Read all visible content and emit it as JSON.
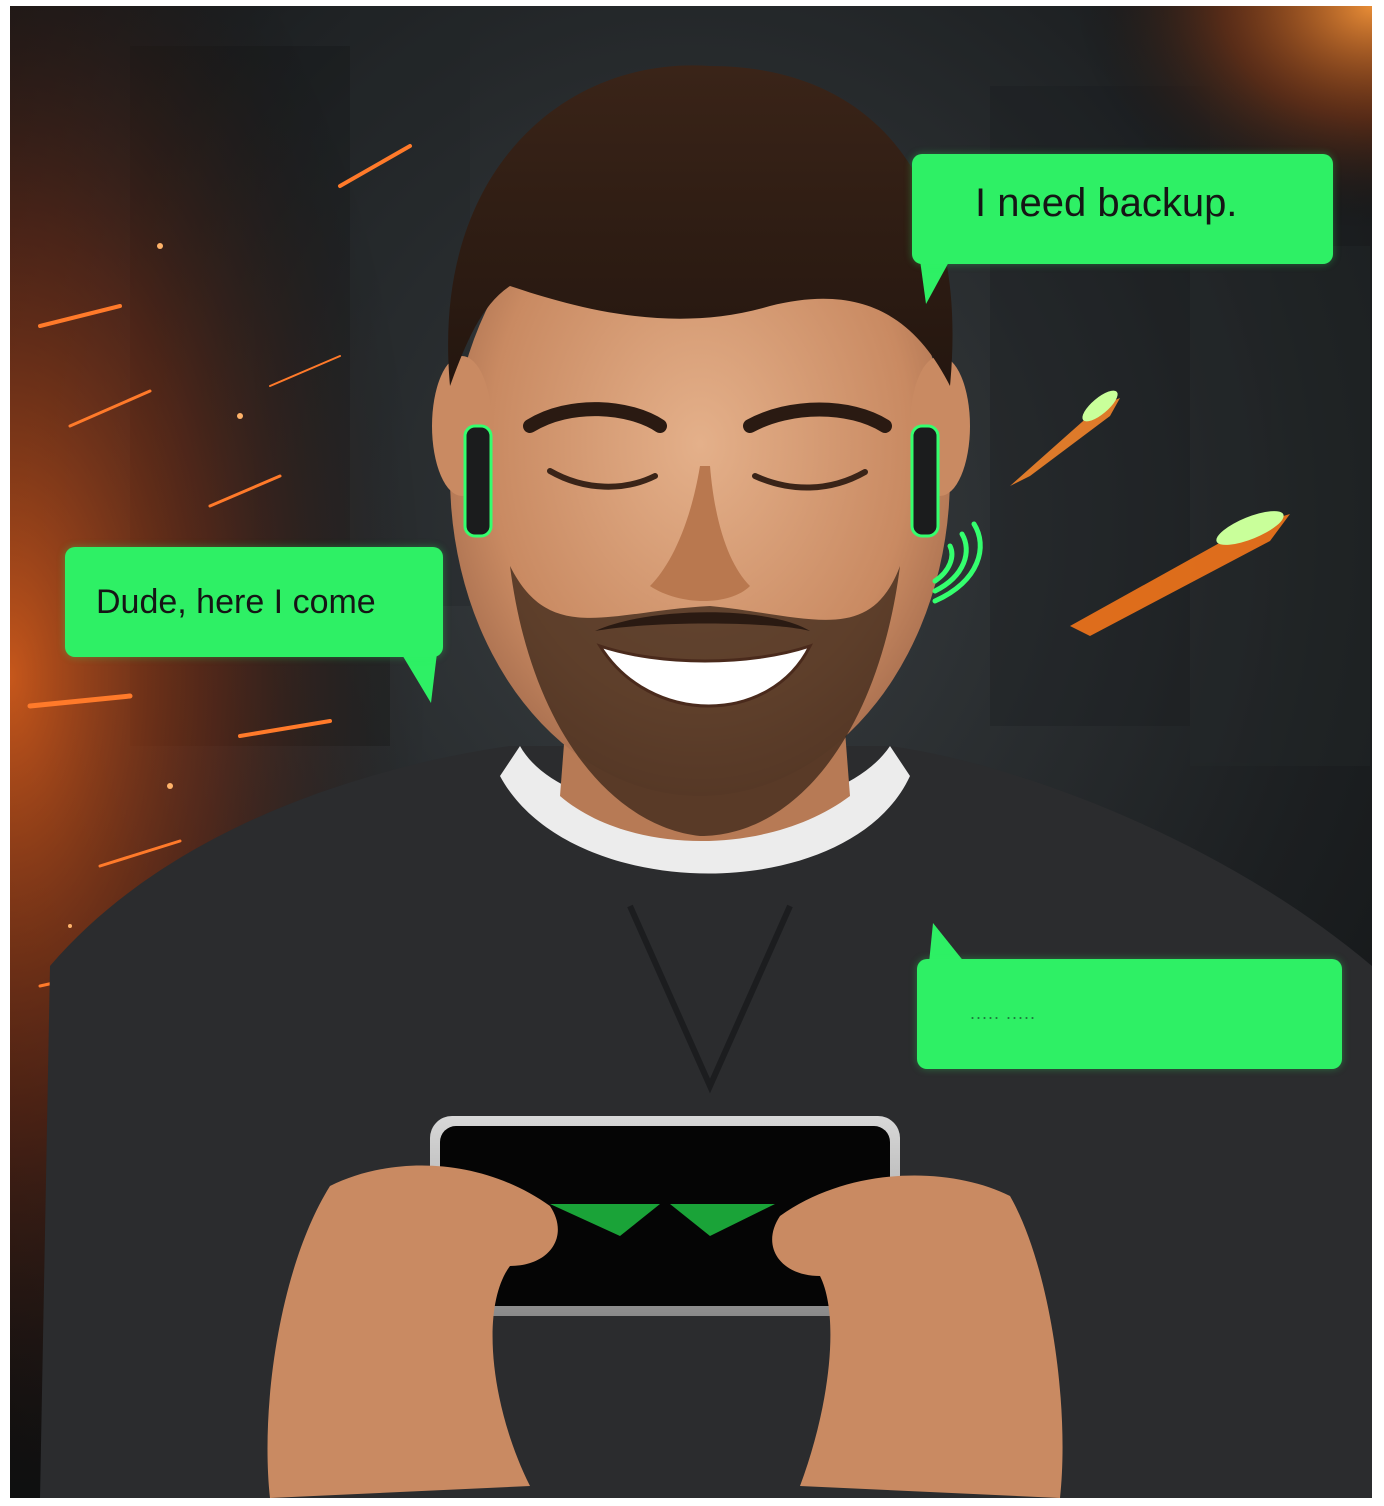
{
  "scene": {
    "description_icon": "person-gaming-on-phone-with-earbuds",
    "colors": {
      "bubble": "#2ef065",
      "bubble_text": "#151515",
      "background_dark": "#1a1d1f",
      "sweater": "#2b2c2e",
      "spark": "#ff6a1a",
      "glow": "#34ff6e"
    }
  },
  "bubbles": {
    "top_right": "I need backup.",
    "left": "Dude, here I come",
    "bottom_right": "..... ....."
  }
}
